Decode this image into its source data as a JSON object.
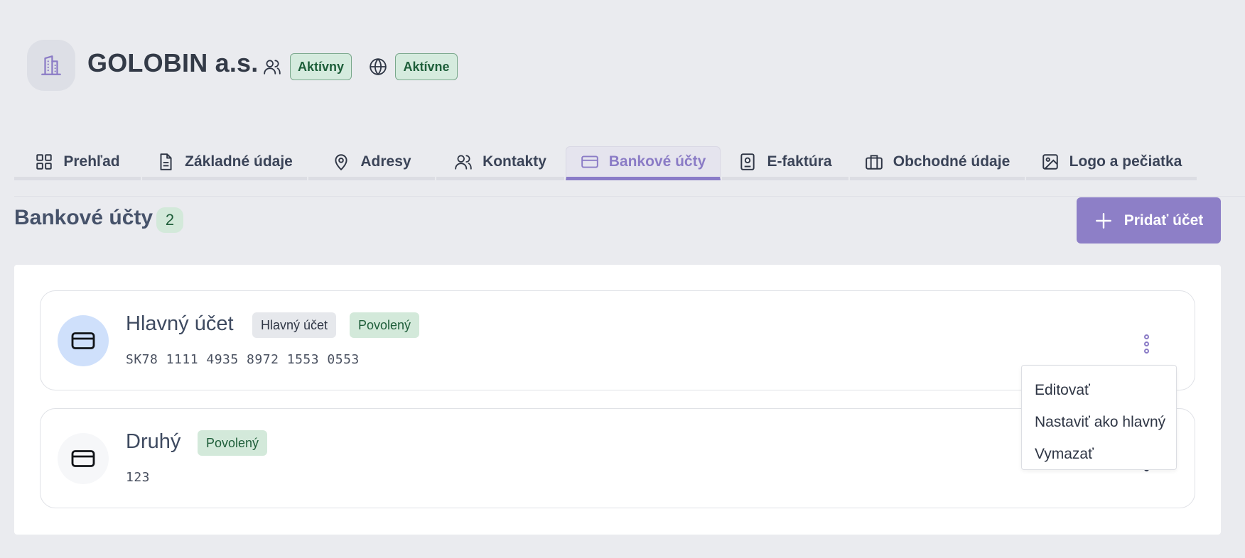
{
  "company": {
    "name": "GOLOBIN a.s.",
    "contact_status": "Aktívny",
    "web_status": "Aktívne"
  },
  "tabs": [
    {
      "label": "Prehľad",
      "icon": "grid-icon",
      "active": false
    },
    {
      "label": "Základné údaje",
      "icon": "document-icon",
      "active": false
    },
    {
      "label": "Adresy",
      "icon": "map-pin-icon",
      "active": false
    },
    {
      "label": "Kontakty",
      "icon": "users-icon",
      "active": false
    },
    {
      "label": "Bankové účty",
      "icon": "credit-card-icon",
      "active": true
    },
    {
      "label": "E-faktúra",
      "icon": "id-badge-icon",
      "active": false
    },
    {
      "label": "Obchodné údaje",
      "icon": "briefcase-icon",
      "active": false
    },
    {
      "label": "Logo a pečiatka",
      "icon": "image-icon",
      "active": false
    }
  ],
  "section": {
    "title": "Bankové účty",
    "count": "2",
    "add_button_label": "Pridať účet"
  },
  "accounts": [
    {
      "name": "Hlavný účet",
      "main_badge": "Hlavný účet",
      "status": "Povolený",
      "number": "SK78 1111 4935 8972 1553 0553"
    },
    {
      "name": "Druhý",
      "status": "Povolený",
      "number": "123"
    }
  ],
  "menu": {
    "items": [
      "Editovať",
      "Nastaviť ako hlavný",
      "Vymazať"
    ]
  },
  "colors": {
    "accent": "#8d7fc7",
    "background": "#eaebef",
    "success_bg": "#d3e9da",
    "success_text": "#1f5e3a"
  }
}
